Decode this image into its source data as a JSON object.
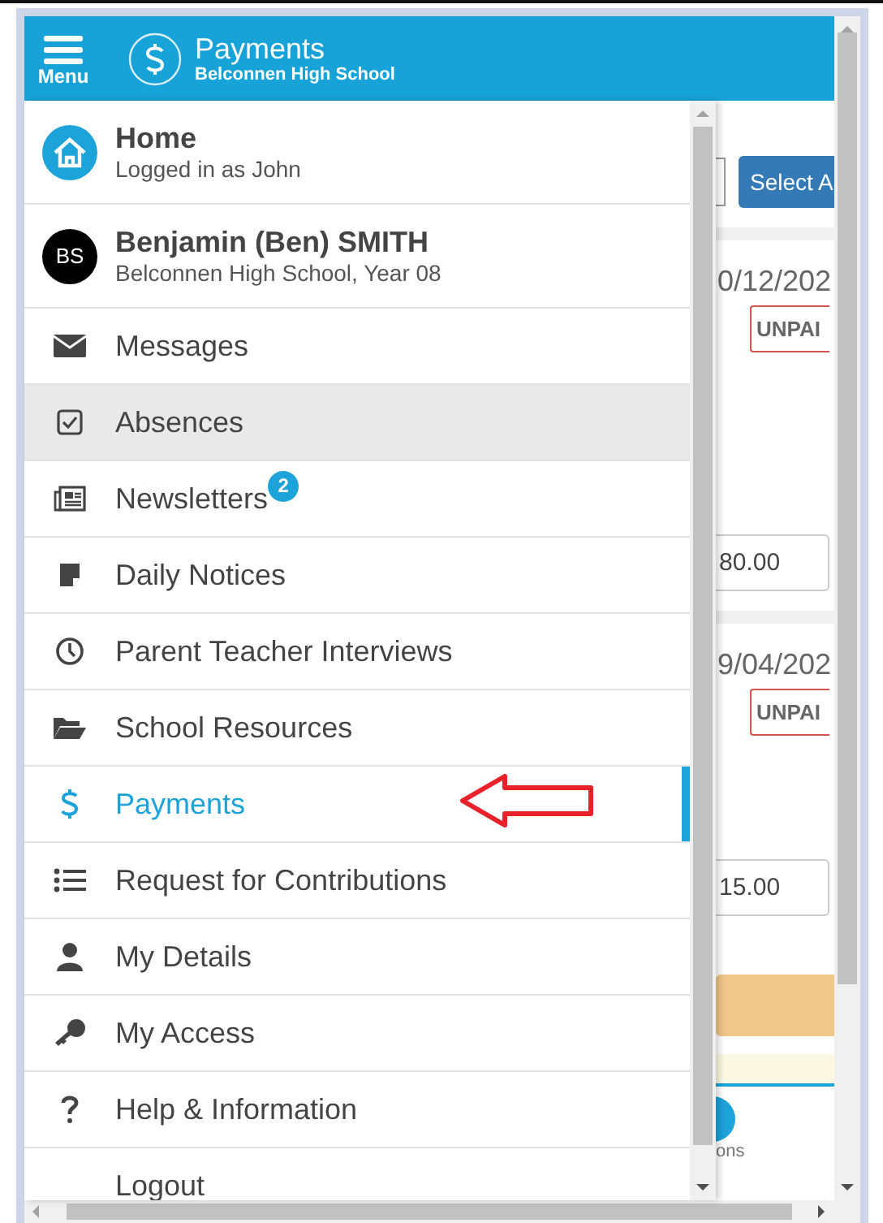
{
  "header": {
    "menu_label": "Menu",
    "title": "Payments",
    "subtitle": "Belconnen High School"
  },
  "menu": {
    "items": [
      {
        "kind": "home",
        "label": "Home",
        "subtitle": "Logged in as John",
        "selected": false,
        "hovered": false
      },
      {
        "kind": "student",
        "label": "Benjamin (Ben) SMITH",
        "subtitle": "Belconnen High School, Year 08",
        "initials": "BS",
        "selected": false,
        "hovered": false
      },
      {
        "kind": "link",
        "label": "Messages",
        "selected": false,
        "hovered": false
      },
      {
        "kind": "link",
        "label": "Absences",
        "selected": false,
        "hovered": true
      },
      {
        "kind": "link",
        "label": "Newsletters",
        "badge": "2",
        "selected": false,
        "hovered": false
      },
      {
        "kind": "link",
        "label": "Daily Notices",
        "selected": false,
        "hovered": false
      },
      {
        "kind": "link",
        "label": "Parent Teacher Interviews",
        "selected": false,
        "hovered": false
      },
      {
        "kind": "link",
        "label": "School Resources",
        "selected": false,
        "hovered": false
      },
      {
        "kind": "link",
        "label": "Payments",
        "selected": true,
        "hovered": false
      },
      {
        "kind": "link",
        "label": "Request for Contributions",
        "selected": false,
        "hovered": false
      },
      {
        "kind": "link",
        "label": "My Details",
        "selected": false,
        "hovered": false
      },
      {
        "kind": "link",
        "label": "My Access",
        "selected": false,
        "hovered": false
      },
      {
        "kind": "link",
        "label": "Help & Information",
        "selected": false,
        "hovered": false
      },
      {
        "kind": "link",
        "label": "Logout",
        "selected": false,
        "hovered": false
      }
    ]
  },
  "background": {
    "button": "Select A",
    "payments": [
      {
        "date": "0/12/202",
        "status": "UNPAI",
        "amount": "80.00"
      },
      {
        "date": "9/04/202",
        "status": "UNPAI",
        "amount": "15.00"
      }
    ],
    "footer_text": "ons"
  }
}
